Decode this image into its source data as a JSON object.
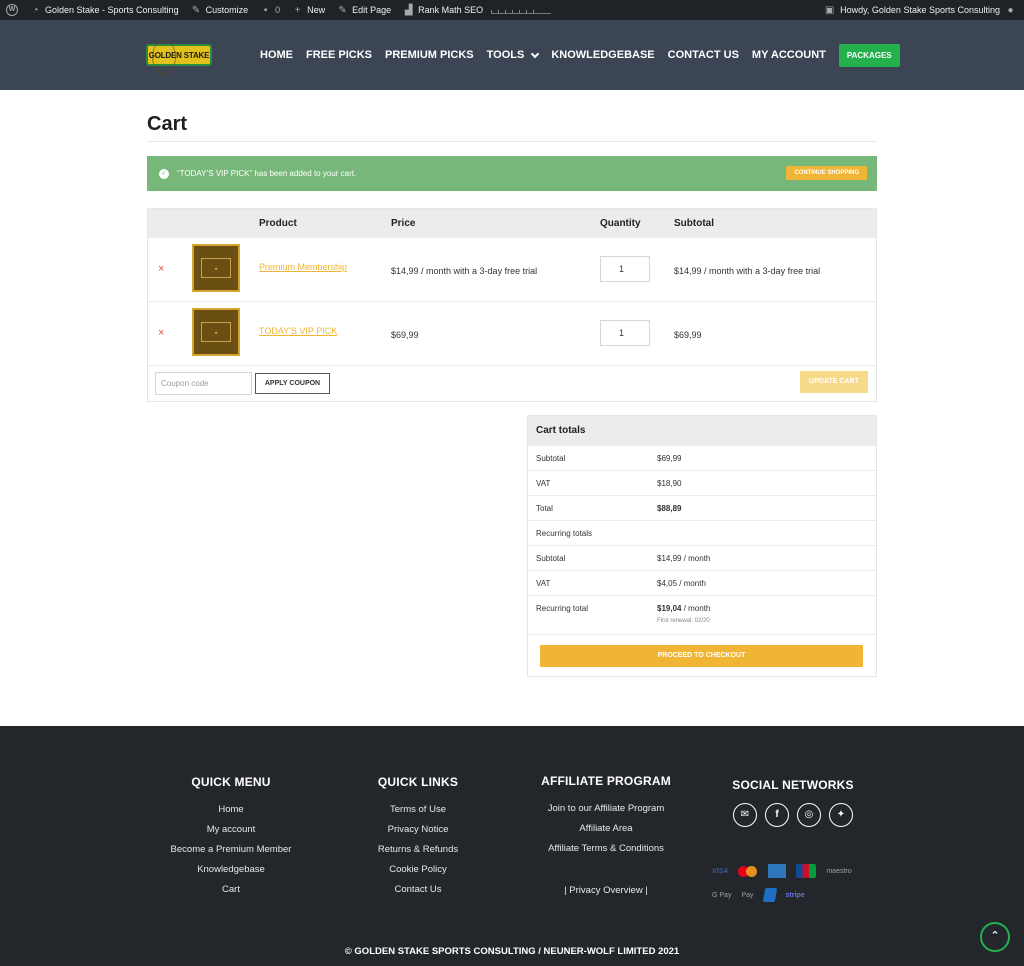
{
  "adminbar": {
    "site_name": "Golden Stake - Sports Consulting",
    "customize": "Customize",
    "comments_count": "0",
    "new": "New",
    "edit_page": "Edit Page",
    "rank_math": "Rank Math SEO",
    "howdy": "Howdy, Golden Stake Sports Consulting"
  },
  "header": {
    "logo_text": "GOLDEN STAKE",
    "nav": [
      "HOME",
      "FREE PICKS",
      "PREMIUM PICKS",
      "TOOLS",
      "KNOWLEDGEBASE",
      "CONTACT US",
      "MY ACCOUNT"
    ],
    "packages": "PACKAGES"
  },
  "page": {
    "title": "Cart",
    "notice": "“TODAY’S VIP PICK” has been added to your cart.",
    "continue_shopping": "CONTINUE SHOPPING"
  },
  "cart": {
    "headers": {
      "product": "Product",
      "price": "Price",
      "quantity": "Quantity",
      "subtotal": "Subtotal"
    },
    "items": [
      {
        "name": "Premium Membership",
        "price": "$14,99 / month with a 3-day free trial",
        "quantity": "1",
        "subtotal": "$14,99 / month with a 3-day free trial",
        "remove": "×"
      },
      {
        "name": "TODAY'S VIP PICK",
        "price": "$69,99",
        "quantity": "1",
        "subtotal": "$69,99",
        "remove": "×"
      }
    ],
    "coupon_placeholder": "Coupon code",
    "apply_coupon": "APPLY COUPON",
    "update_cart": "UPDATE CART"
  },
  "totals": {
    "heading": "Cart totals",
    "rows": [
      {
        "label": "Subtotal",
        "value": "$69,99"
      },
      {
        "label": "VAT",
        "value": "$18,90"
      },
      {
        "label": "Total",
        "value": "$88,89"
      },
      {
        "label": "Recurring totals",
        "value": ""
      },
      {
        "label": "Subtotal",
        "value": "$14,99 / month"
      },
      {
        "label": "VAT",
        "value": "$4,05 / month"
      }
    ],
    "recurring_total_label": "Recurring total",
    "recurring_total_amount": "$19,04",
    "recurring_total_suffix": " / month",
    "first_renewal": "First renewal: 02/20",
    "checkout": "PROCEED TO CHECKOUT"
  },
  "footer": {
    "quick_menu": {
      "title": "QUICK MENU",
      "links": [
        "Home",
        "My account",
        "Become a Premium Member",
        "Knowledgebase",
        "Cart"
      ]
    },
    "quick_links": {
      "title": "QUICK LINKS",
      "links": [
        "Terms of Use",
        "Privacy Notice",
        "Returns & Refunds",
        "Cookie Policy",
        "Contact Us"
      ]
    },
    "affiliate": {
      "title": "AFFILIATE PROGRAM",
      "links": [
        "Join to our Affiliate Program",
        "Affiliate Area",
        "Affiliate Terms & Conditions"
      ],
      "privacy_overview": "| Privacy Overview |"
    },
    "social": {
      "title": "SOCIAL NETWORKS",
      "icons": [
        "email-icon",
        "facebook-icon",
        "instagram-icon",
        "twitter-icon"
      ]
    },
    "payments": {
      "visa": "VISA",
      "maestro": "maestro",
      "gpay": "G Pay",
      "applepay": " Pay",
      "stripe": "stripe"
    },
    "copyright": "© GOLDEN STAKE SPORTS CONSULTING / NEUNER-WOLF LIMITED 2021"
  },
  "colors": {
    "accent": "#f0b535",
    "notice": "#77b77a",
    "packages": "#22b14c",
    "header_bg": "#3c4554",
    "footer_bg": "#23272c"
  }
}
